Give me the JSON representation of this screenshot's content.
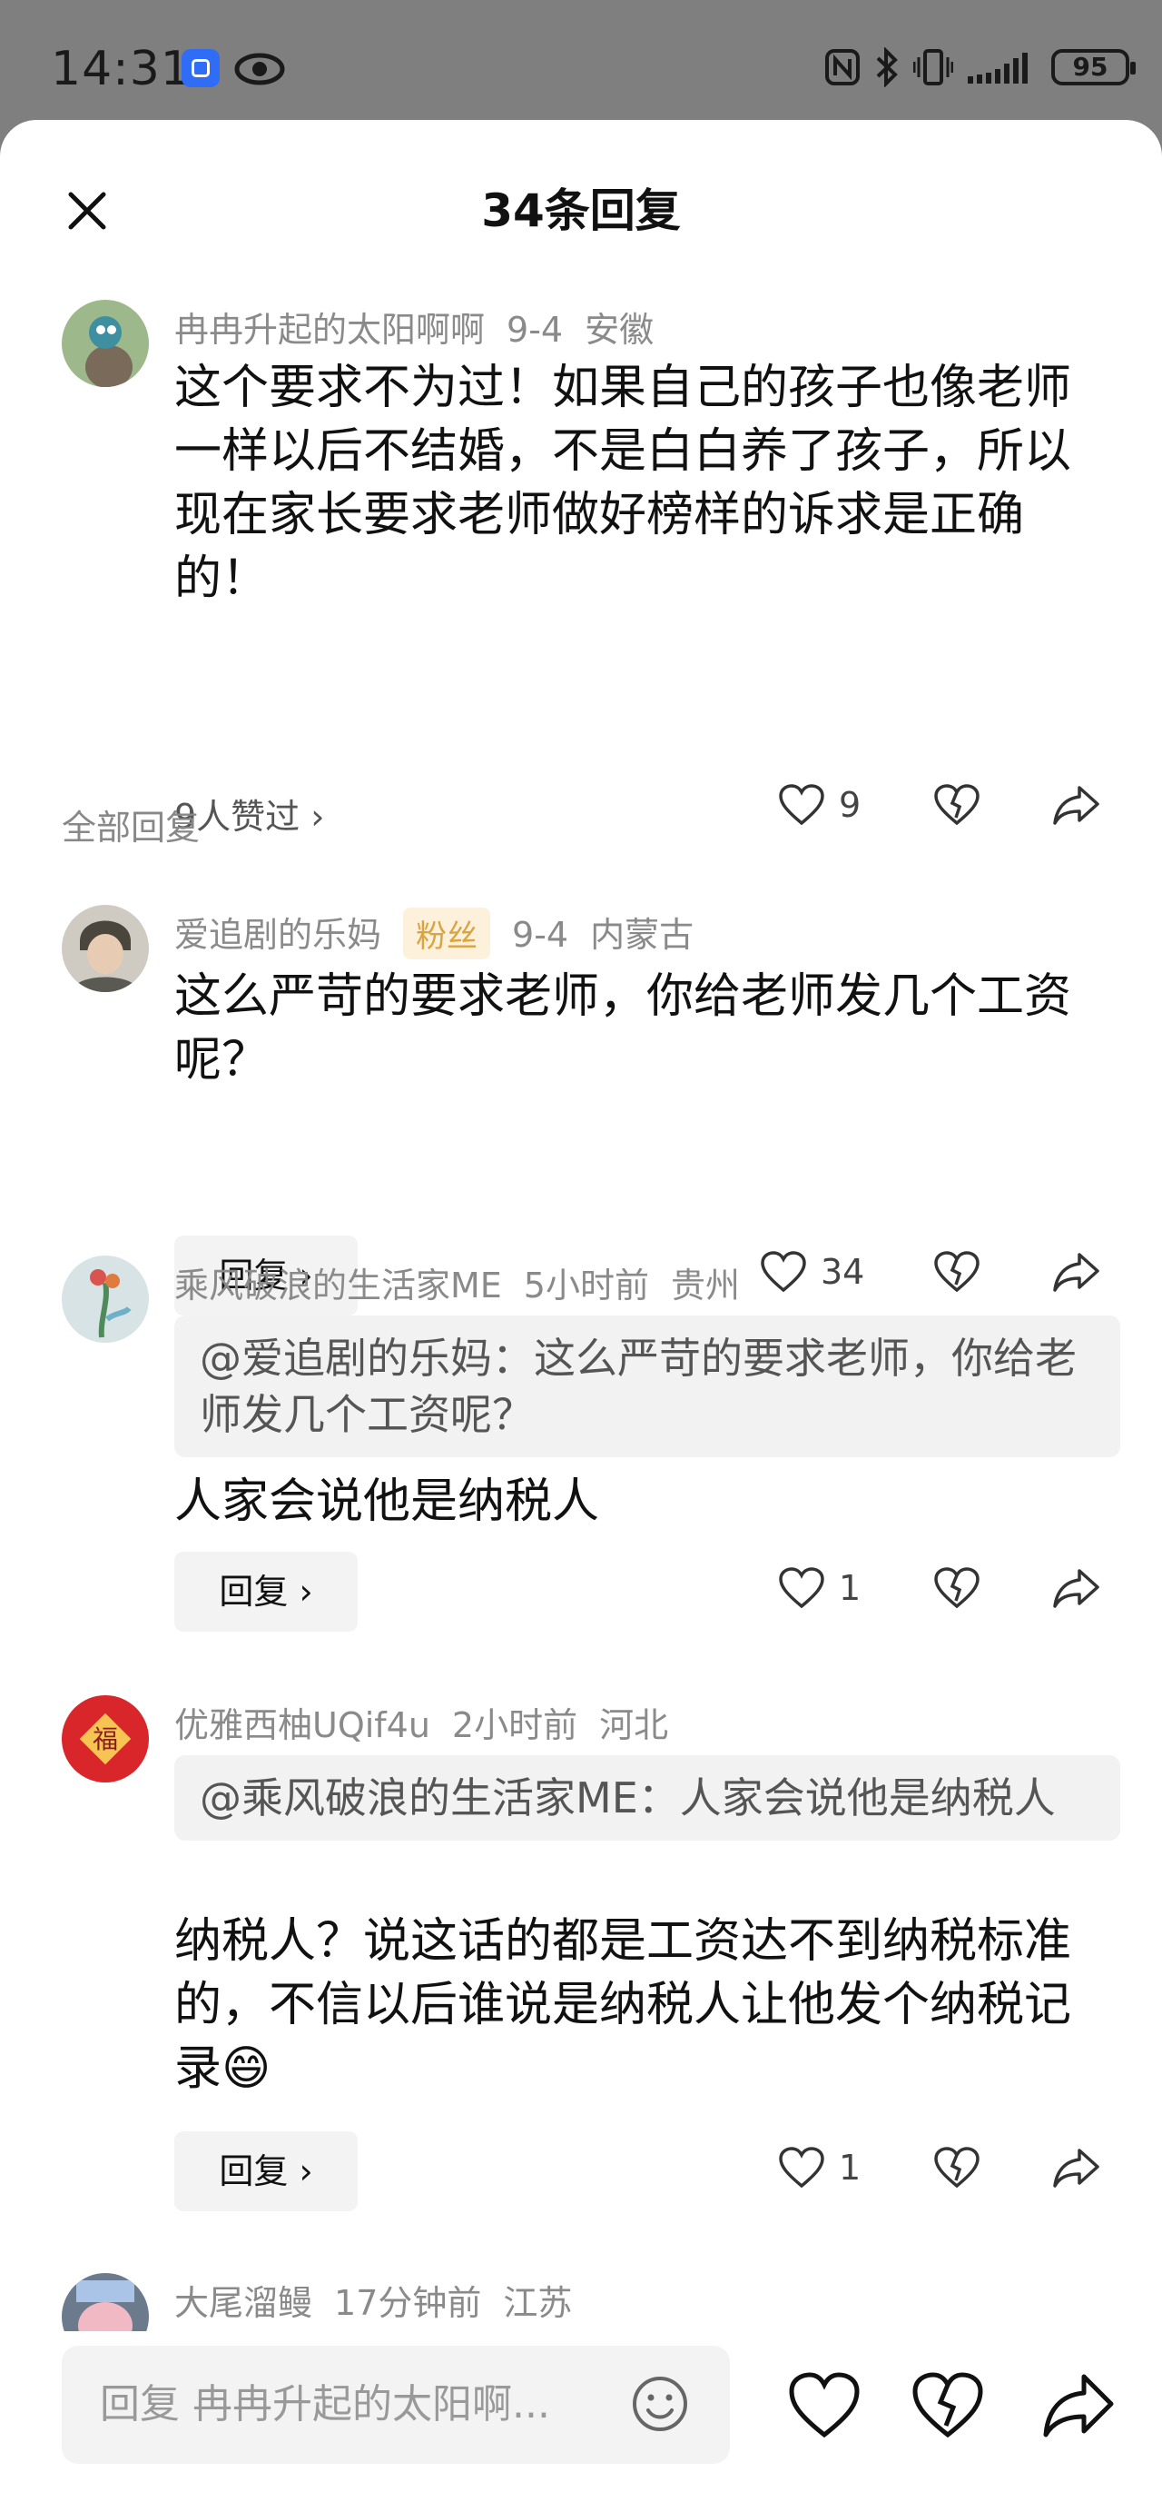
{
  "status_bar": {
    "time": "14:31",
    "battery": "95"
  },
  "sheet": {
    "title": "34条回复"
  },
  "main_comment": {
    "username": "冉冉升起的太阳啊啊",
    "date": "9-4",
    "location": "安徽",
    "text": "这个要求不为过！如果自己的孩子也像老师一样以后不结婚，不是白白养了孩子，所以现在家长要求老师做好榜样的诉求是正确的！",
    "likers": "9人赞过 ›",
    "likes": "9"
  },
  "section_label": "全部回复",
  "replies": [
    {
      "username": "爱追剧的乐妈",
      "badge": "粉丝",
      "date": "9-4",
      "location": "内蒙古",
      "text": "这么严苛的要求老师，你给老师发几个工资呢？",
      "reply_label": "回复 ›",
      "likes": "34"
    },
    {
      "username": "乘风破浪的生活家ME",
      "date": "5小时前",
      "location": "贵州",
      "quote": "@爱追剧的乐妈：这么严苛的要求老师，你给老师发几个工资呢？",
      "text": "人家会说他是纳税人",
      "reply_label": "回复 ›",
      "likes": "1"
    },
    {
      "username": "优雅西柚UQif4u",
      "date": "2小时前",
      "location": "河北",
      "quote": "@乘风破浪的生活家ME：人家会说他是纳税人",
      "text": "纳税人？说这话的都是工资达不到纳税标准的，不信以后谁说是纳税人让他发个纳税记录😄",
      "reply_label": "回复 ›",
      "likes": "1"
    },
    {
      "username": "大尾溜鳗",
      "date": "17分钟前",
      "location": "江苏"
    }
  ],
  "bottom_bar": {
    "input_placeholder": "回复 冉冉升起的太阳啊..."
  },
  "icons": [
    "close-icon",
    "heart-icon",
    "broken-heart-icon",
    "share-icon",
    "emoji-icon",
    "eye-icon",
    "nfc-icon",
    "bluetooth-icon",
    "vibrate-icon",
    "signal-icon"
  ]
}
